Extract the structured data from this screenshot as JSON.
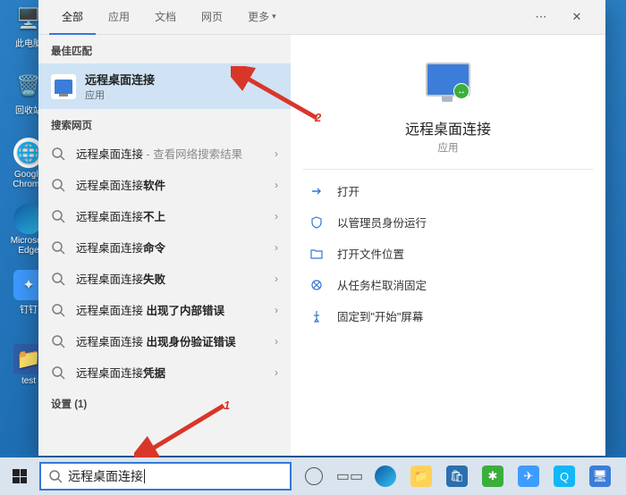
{
  "desktop_icons": [
    {
      "label": "此电脑",
      "icon": "pc"
    },
    {
      "label": "回收站",
      "icon": "recycle"
    },
    {
      "label": "Google\nChrome",
      "icon": "chrome"
    },
    {
      "label": "Microsoft\nEdge",
      "icon": "edge"
    },
    {
      "label": "钉钉",
      "icon": "dingtalk"
    },
    {
      "label": "test",
      "icon": "folder"
    }
  ],
  "tabs": {
    "all": "全部",
    "apps": "应用",
    "docs": "文档",
    "web": "网页",
    "more": "更多"
  },
  "sections": {
    "best": "最佳匹配",
    "web": "搜索网页",
    "settings": "设置 (1)"
  },
  "best_match": {
    "title": "远程桌面连接",
    "subtitle": "应用"
  },
  "web_results": [
    {
      "prefix": "远程桌面连接",
      "suffix": "",
      "hint": " - 查看网络搜索结果"
    },
    {
      "prefix": "远程桌面连接",
      "suffix": "软件",
      "hint": ""
    },
    {
      "prefix": "远程桌面连接",
      "suffix": "不上",
      "hint": ""
    },
    {
      "prefix": "远程桌面连接",
      "suffix": "命令",
      "hint": ""
    },
    {
      "prefix": "远程桌面连接",
      "suffix": "失败",
      "hint": ""
    },
    {
      "prefix": "远程桌面连接 ",
      "suffix": "出现了内部错误",
      "hint": ""
    },
    {
      "prefix": "远程桌面连接 ",
      "suffix": "出现身份验证错误",
      "hint": ""
    },
    {
      "prefix": "远程桌面连接",
      "suffix": "凭据",
      "hint": ""
    }
  ],
  "details": {
    "title": "远程桌面连接",
    "subtitle": "应用",
    "actions": [
      {
        "icon": "open",
        "label": "打开"
      },
      {
        "icon": "admin",
        "label": "以管理员身份运行"
      },
      {
        "icon": "folder",
        "label": "打开文件位置"
      },
      {
        "icon": "unpin",
        "label": "从任务栏取消固定"
      },
      {
        "icon": "pin",
        "label": "固定到\"开始\"屏幕"
      }
    ]
  },
  "search_input": "远程桌面连接",
  "annotations": {
    "a1": "1",
    "a2": "2"
  }
}
